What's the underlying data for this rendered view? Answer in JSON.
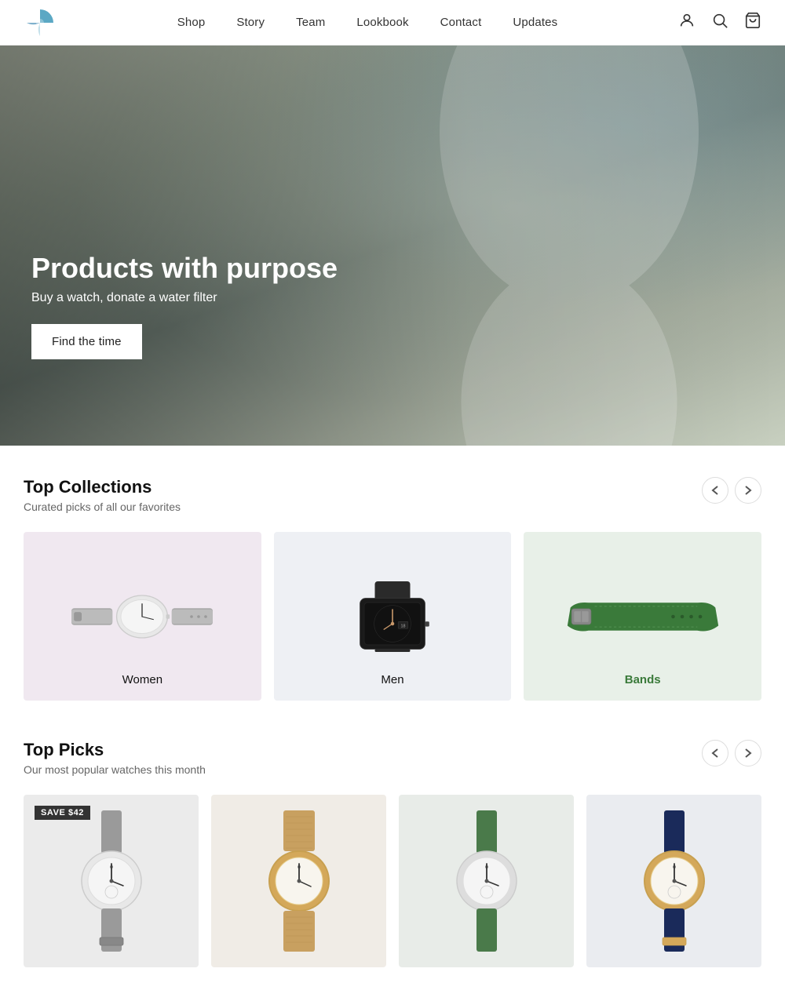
{
  "nav": {
    "logo_alt": "Brand Logo",
    "links": [
      {
        "label": "Shop",
        "href": "#"
      },
      {
        "label": "Story",
        "href": "#"
      },
      {
        "label": "Team",
        "href": "#"
      },
      {
        "label": "Lookbook",
        "href": "#"
      },
      {
        "label": "Contact",
        "href": "#"
      },
      {
        "label": "Updates",
        "href": "#"
      }
    ],
    "icons": [
      "account-icon",
      "search-icon",
      "cart-icon"
    ]
  },
  "hero": {
    "title": "Products with purpose",
    "subtitle": "Buy a watch, donate a water filter",
    "cta_label": "Find the time"
  },
  "top_collections": {
    "title": "Top Collections",
    "subtitle": "Curated picks of all our favorites",
    "prev_label": "‹",
    "next_label": "›",
    "items": [
      {
        "label": "Women",
        "bg": "women"
      },
      {
        "label": "Men",
        "bg": "men"
      },
      {
        "label": "Bands",
        "bg": "bands"
      }
    ]
  },
  "top_picks": {
    "title": "Top Picks",
    "subtitle": "Our most popular watches this month",
    "prev_label": "‹",
    "next_label": "›",
    "save_badge": "SAVE $42",
    "items": [
      {
        "color": "gray",
        "band": "gray"
      },
      {
        "color": "gold",
        "band": "mesh"
      },
      {
        "color": "silver",
        "band": "green"
      },
      {
        "color": "gold",
        "band": "navy"
      }
    ]
  }
}
